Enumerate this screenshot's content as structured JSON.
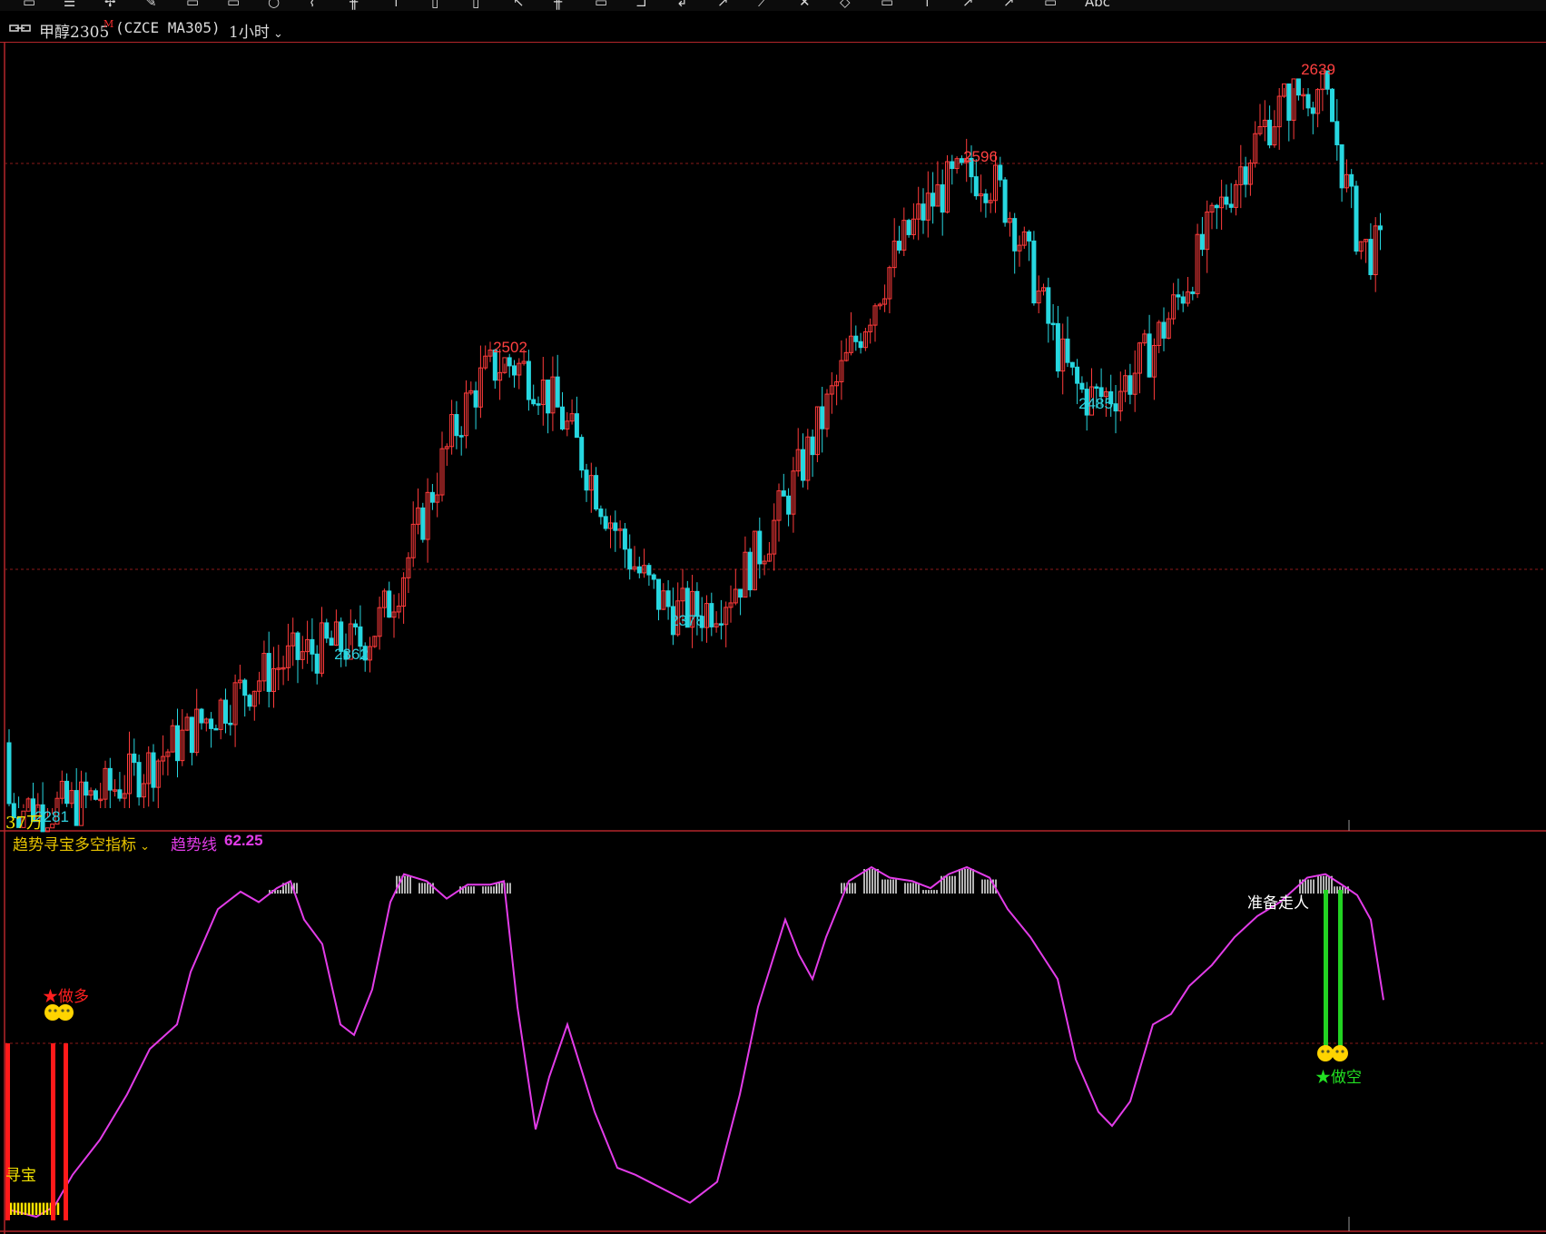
{
  "toolbar": {
    "icons": [
      "window-icon",
      "menu-icon",
      "crosshair-icon",
      "pen-icon",
      "layout-icon",
      "grid-icon",
      "circle-icon",
      "line-icon",
      "ruler-icon",
      "zoom-icon",
      "text-icon",
      "arrow-icon",
      "box-icon",
      "fork-icon",
      "tool-icon",
      "bracket-icon",
      "tag-icon",
      "trend-icon",
      "cross-icon",
      "diamond-icon",
      "pin-icon",
      "up-icon",
      "right-icon",
      "calc-icon",
      "abc-icon"
    ]
  },
  "header": {
    "symbol_name": "甲醇2305",
    "symbol_flag": "M",
    "exchange_code": "(CZCE MA305)",
    "period": "1小时"
  },
  "main_chart": {
    "annotations": {
      "high_1": "2502",
      "high_2": "2596",
      "high_3": "2639",
      "low_1": "2281",
      "low_2": "2362",
      "low_3": "2378",
      "low_4": "2485"
    },
    "volume_label": "37万",
    "colors": {
      "up": "#ff3b3b",
      "down": "#27d7e0",
      "grid": "#8b1a1a",
      "high_label": "#ff4040",
      "low_label": "#2fd3e0"
    }
  },
  "indicator": {
    "title": "趋势寻宝多空指标",
    "line_name": "趋势线",
    "line_value": "62.25",
    "signals": {
      "long": "★做多",
      "short": "★做空",
      "bottom": "寻宝",
      "exit": "准备走人"
    },
    "colors": {
      "line": "#e23ce8",
      "long_bar": "#ff1a1a",
      "short_bar": "#22d322",
      "bottom_fill": "#ffe400"
    }
  },
  "chart_data": {
    "type": "candlestick",
    "symbol": "MA305",
    "price_range": [
      2281,
      2639
    ],
    "indicator_range": [
      0,
      100
    ],
    "indicator_value": 62.25,
    "labeled_extremes": [
      {
        "type": "low",
        "value": 2281
      },
      {
        "type": "low",
        "value": 2362
      },
      {
        "type": "high",
        "value": 2502
      },
      {
        "type": "low",
        "value": 2378
      },
      {
        "type": "high",
        "value": 2596
      },
      {
        "type": "low",
        "value": 2485
      },
      {
        "type": "high",
        "value": 2639
      }
    ]
  }
}
